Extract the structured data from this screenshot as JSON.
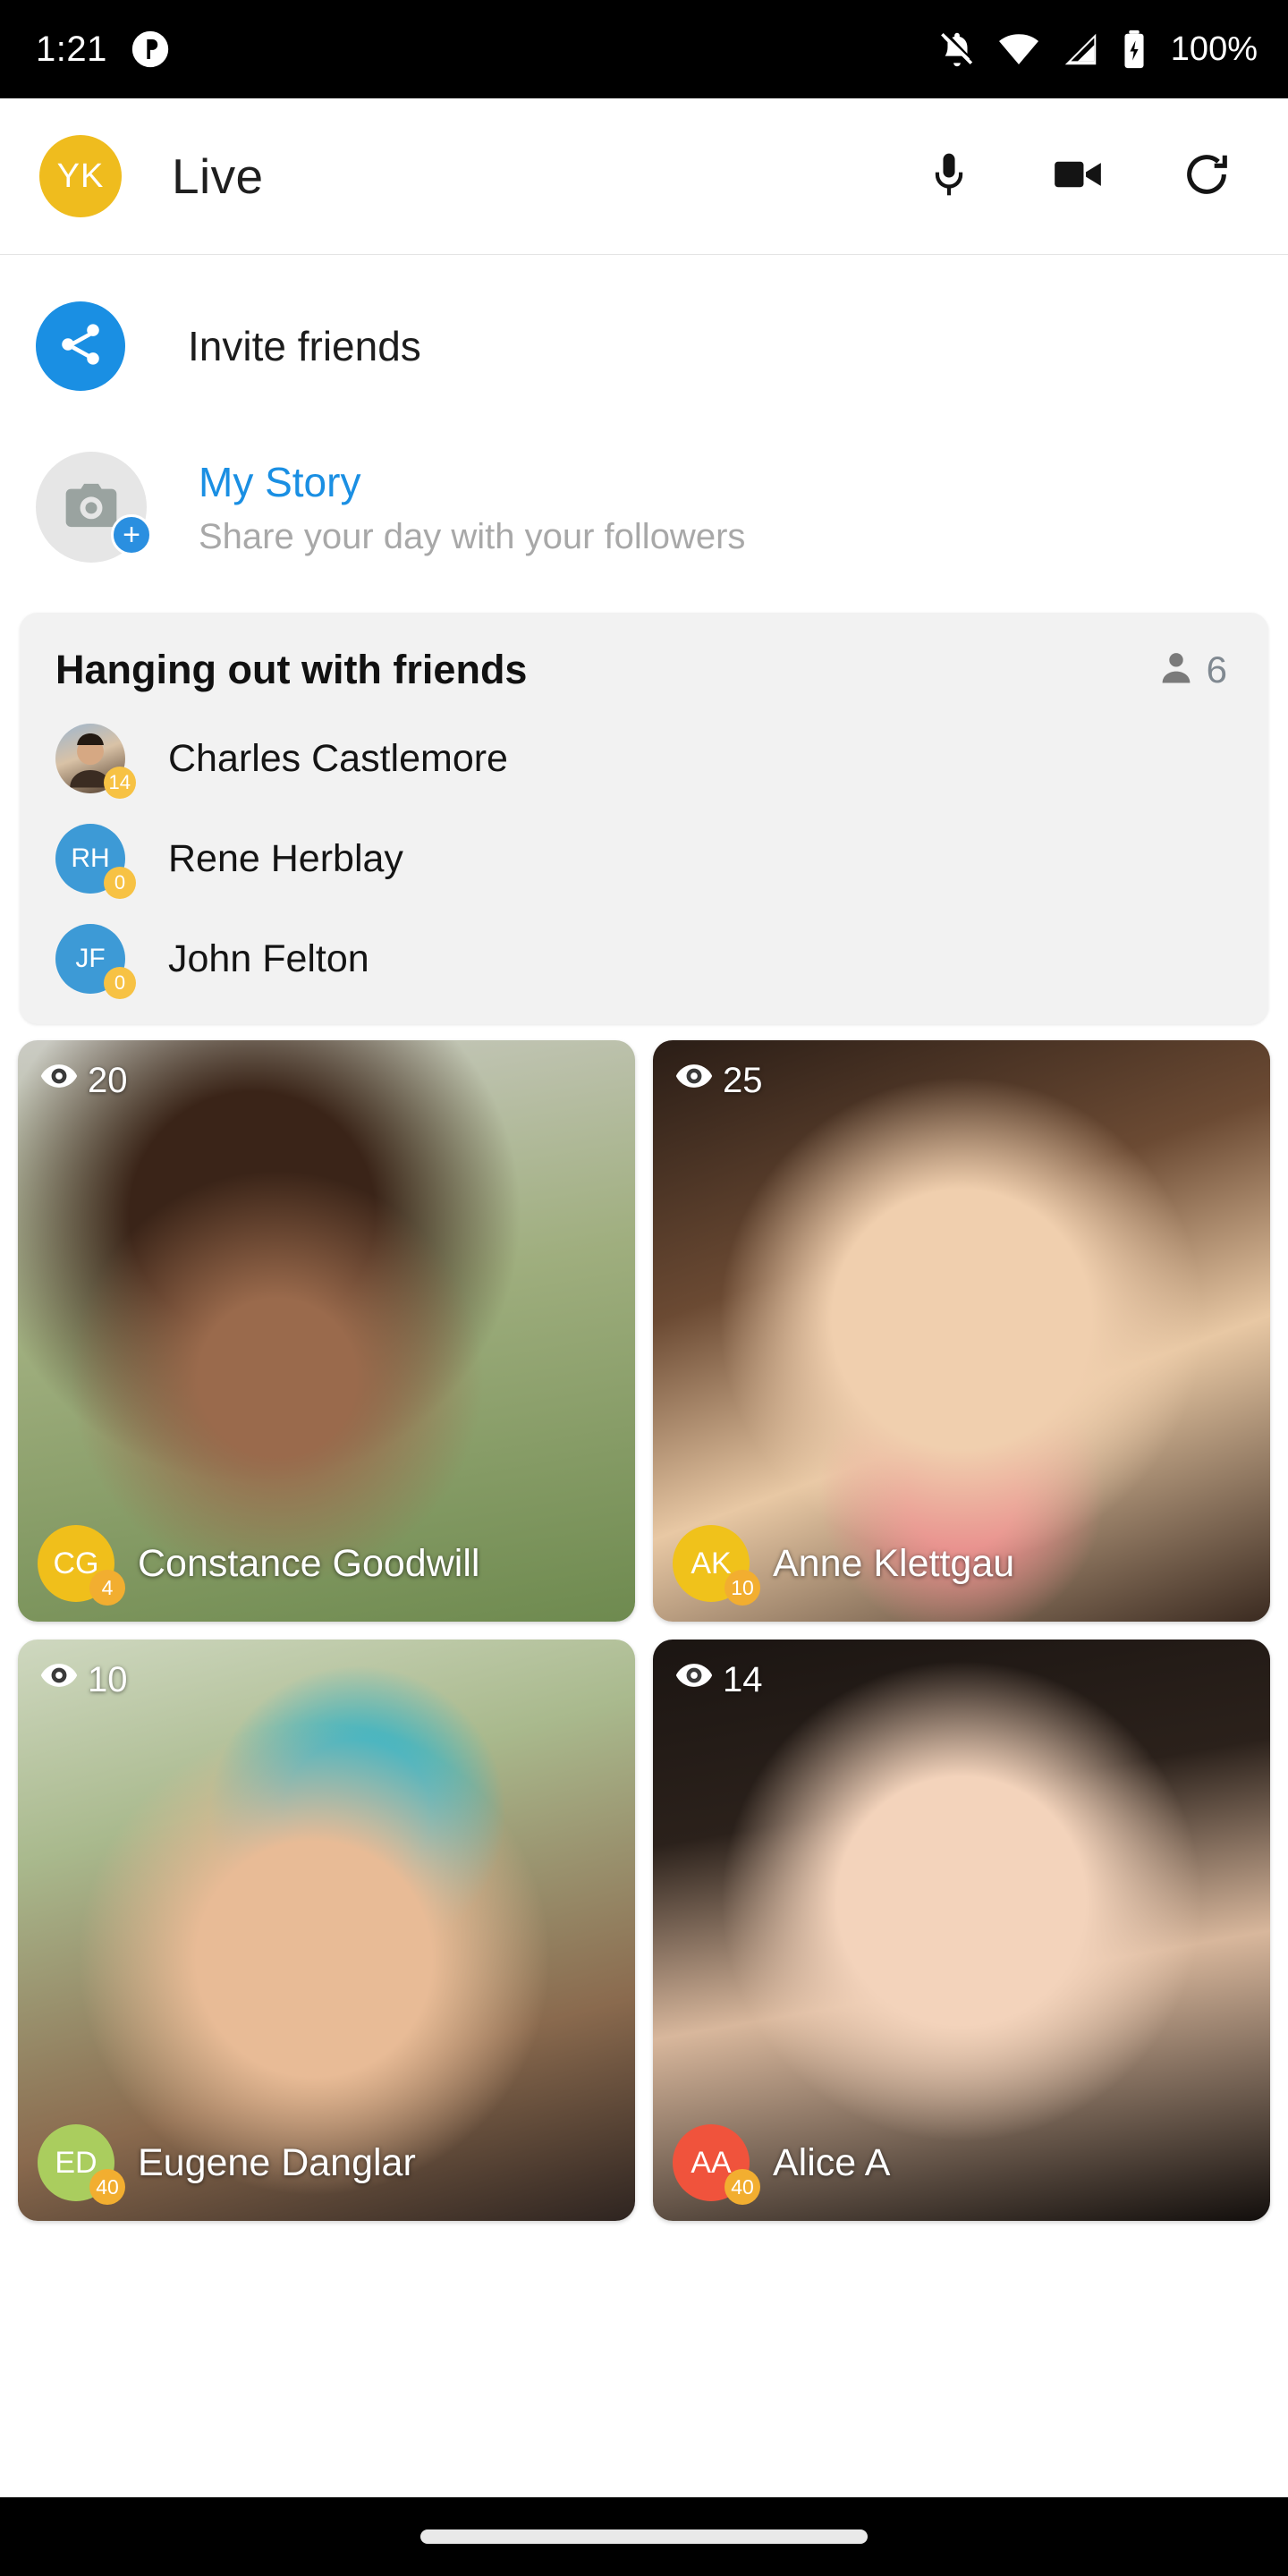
{
  "status_bar": {
    "time": "1:21",
    "notification_icon": "app-notification-icon",
    "icons": [
      "notifications-off-icon",
      "wifi-icon",
      "cellular-signal-icon",
      "battery-charging-icon"
    ],
    "battery_text": "100%"
  },
  "app_bar": {
    "avatar_initials": "YK",
    "avatar_color": "#efbc1e",
    "title": "Live",
    "actions": [
      {
        "name": "microphone-button",
        "icon": "microphone-icon"
      },
      {
        "name": "video-camera-button",
        "icon": "video-camera-icon"
      },
      {
        "name": "refresh-button",
        "icon": "refresh-icon"
      }
    ]
  },
  "invite": {
    "label": "Invite friends",
    "icon": "share-icon",
    "circle_color": "#1a8fe3"
  },
  "my_story": {
    "title": "My Story",
    "subtitle": "Share your day with your followers",
    "camera_icon": "camera-icon",
    "plus_badge": "+",
    "title_color": "#1a8fe3"
  },
  "hangout": {
    "title": "Hanging out with friends",
    "people_icon": "person-icon",
    "count": "6",
    "friends": [
      {
        "name": "Charles Castlemore",
        "initials": "",
        "badge": "14",
        "avatar_type": "photo",
        "color": "#8a6a52"
      },
      {
        "name": "Rene Herblay",
        "initials": "RH",
        "badge": "0",
        "avatar_type": "initials",
        "color": "#3d9ad6"
      },
      {
        "name": "John Felton",
        "initials": "JF",
        "badge": "0",
        "avatar_type": "initials",
        "color": "#3d9ad6"
      }
    ]
  },
  "live_grid": {
    "view_icon": "eye-icon",
    "tiles": [
      {
        "name": "Constance Goodwill",
        "initials": "CG",
        "views": "20",
        "badge": "4",
        "avatar_color": "#f0bf1b",
        "bg": "g1"
      },
      {
        "name": "Anne Klettgau",
        "initials": "AK",
        "views": "25",
        "badge": "10",
        "avatar_color": "#f0c21b",
        "bg": "g2"
      },
      {
        "name": "Eugene Danglar",
        "initials": "ED",
        "views": "10",
        "badge": "40",
        "avatar_color": "#aacd5e",
        "bg": "g3"
      },
      {
        "name": "Alice A",
        "initials": "AA",
        "views": "14",
        "badge": "40",
        "avatar_color": "#f0533c",
        "bg": "g4"
      }
    ]
  },
  "nav_bar": {
    "gesture_pill": "home-gesture-pill"
  }
}
